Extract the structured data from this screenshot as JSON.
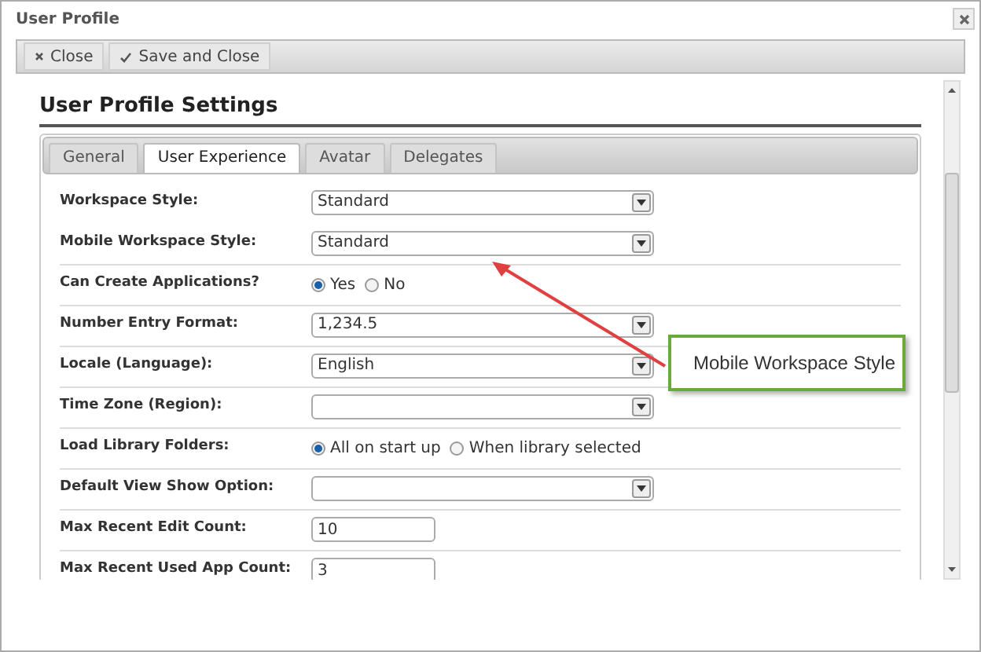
{
  "window": {
    "title": "User Profile"
  },
  "toolbar": [
    {
      "kind": "close",
      "label": "Close"
    },
    {
      "kind": "save",
      "label": "Save and Close"
    }
  ],
  "heading": "User Profile Settings",
  "tabs": [
    {
      "label": "General",
      "selected": false
    },
    {
      "label": "User Experience",
      "selected": true
    },
    {
      "label": "Avatar",
      "selected": false
    },
    {
      "label": "Delegates",
      "selected": false
    }
  ],
  "fields": [
    {
      "kind": "select",
      "label": "Workspace Style:",
      "value": "Standard"
    },
    {
      "kind": "select",
      "label": "Mobile Workspace Style:",
      "value": "Standard"
    },
    {
      "kind": "radio",
      "label": "Can Create Applications?",
      "options": [
        {
          "label": "Yes",
          "selected": true
        },
        {
          "label": "No",
          "selected": false
        }
      ]
    },
    {
      "kind": "select",
      "label": "Number Entry Format:",
      "value": "1,234.5"
    },
    {
      "kind": "select",
      "label": "Locale (Language):",
      "value": "English"
    },
    {
      "kind": "select",
      "label": "Time Zone (Region):"
    },
    {
      "kind": "radio",
      "label": "Load Library Folders:",
      "options": [
        {
          "label": "All on start up",
          "selected": true
        },
        {
          "label": "When library selected",
          "selected": false
        }
      ]
    },
    {
      "kind": "select",
      "label": "Default View Show Option:"
    },
    {
      "kind": "text",
      "label": "Max Recent Edit Count:",
      "value": "10"
    },
    {
      "kind": "text",
      "label": "Max Recent Used App Count:",
      "value": "3"
    }
  ],
  "callout": {
    "text": "Mobile Workspace Style"
  }
}
